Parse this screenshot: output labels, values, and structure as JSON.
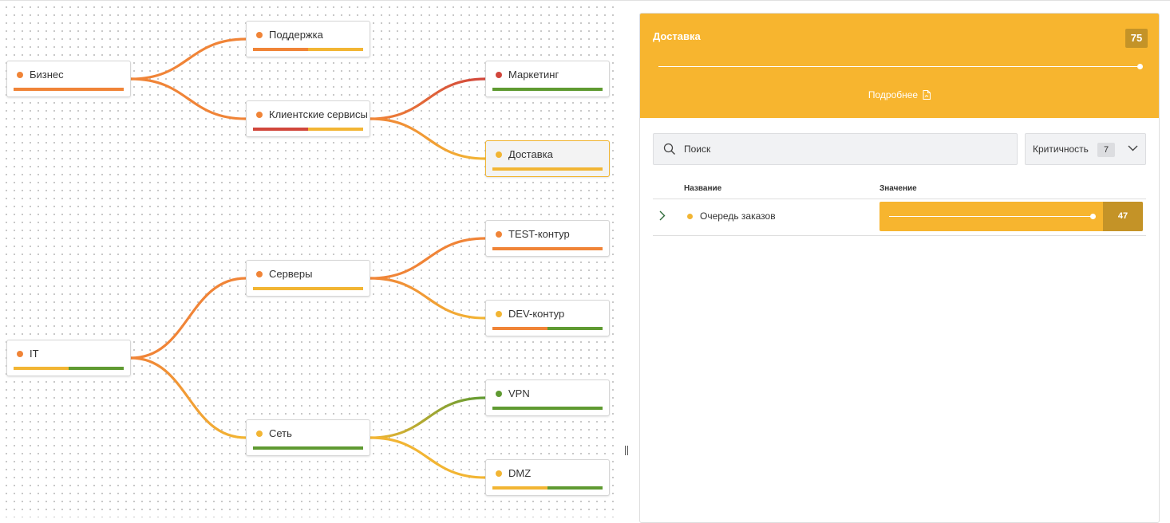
{
  "colors": {
    "orange": "#f08437",
    "yellow": "#f2b533",
    "green": "#5f9a31",
    "red": "#d1463b",
    "accent": "#f7b52f",
    "accent_dark": "#c49327"
  },
  "tree": {
    "nodes": [
      {
        "id": "biznes",
        "label": "Бизнес",
        "status": "orange",
        "bar": [
          "orange"
        ]
      },
      {
        "id": "podderzhka",
        "label": "Поддержка",
        "status": "orange",
        "bar": [
          "orange",
          "yellow"
        ]
      },
      {
        "id": "klient",
        "label": "Клиентские сервисы",
        "status": "orange",
        "bar": [
          "red",
          "yellow"
        ]
      },
      {
        "id": "marketing",
        "label": "Маркетинг",
        "status": "red",
        "bar": [
          "green"
        ]
      },
      {
        "id": "dostavka",
        "label": "Доставка",
        "status": "yellow",
        "bar": [
          "yellow"
        ],
        "selected": true
      },
      {
        "id": "test",
        "label": "TEST-контур",
        "status": "orange",
        "bar": [
          "orange"
        ]
      },
      {
        "id": "servery",
        "label": "Серверы",
        "status": "orange",
        "bar": [
          "yellow"
        ]
      },
      {
        "id": "dev",
        "label": "DEV-контур",
        "status": "yellow",
        "bar": [
          "orange",
          "green"
        ]
      },
      {
        "id": "it",
        "label": "IT",
        "status": "orange",
        "bar": [
          "yellow",
          "green"
        ]
      },
      {
        "id": "vpn",
        "label": "VPN",
        "status": "green",
        "bar": [
          "green"
        ]
      },
      {
        "id": "set",
        "label": "Сеть",
        "status": "yellow",
        "bar": [
          "green"
        ]
      },
      {
        "id": "dmz",
        "label": "DMZ",
        "status": "yellow",
        "bar": [
          "yellow",
          "green"
        ]
      }
    ],
    "edges": [
      {
        "from": "biznes",
        "to": "podderzhka",
        "c1": "orange",
        "c2": "orange"
      },
      {
        "from": "biznes",
        "to": "klient",
        "c1": "orange",
        "c2": "orange"
      },
      {
        "from": "klient",
        "to": "marketing",
        "c1": "orange",
        "c2": "red"
      },
      {
        "from": "klient",
        "to": "dostavka",
        "c1": "orange",
        "c2": "yellow"
      },
      {
        "from": "servery",
        "to": "test",
        "c1": "orange",
        "c2": "orange"
      },
      {
        "from": "servery",
        "to": "dev",
        "c1": "orange",
        "c2": "yellow"
      },
      {
        "from": "it",
        "to": "servery",
        "c1": "orange",
        "c2": "orange"
      },
      {
        "from": "it",
        "to": "set",
        "c1": "orange",
        "c2": "yellow"
      },
      {
        "from": "set",
        "to": "vpn",
        "c1": "yellow",
        "c2": "green"
      },
      {
        "from": "set",
        "to": "dmz",
        "c1": "yellow",
        "c2": "yellow"
      }
    ]
  },
  "details": {
    "title": "Доставка",
    "score": "75",
    "score_level": 1.0,
    "more_link": "Подробнее",
    "search_placeholder": "Поиск",
    "filter": {
      "label": "Критичность",
      "count": "7"
    },
    "table": {
      "columns": [
        "Название",
        "Значение"
      ],
      "rows": [
        {
          "name": "Очередь заказов",
          "status": "yellow",
          "value": "47",
          "level": 1.0
        }
      ]
    }
  }
}
